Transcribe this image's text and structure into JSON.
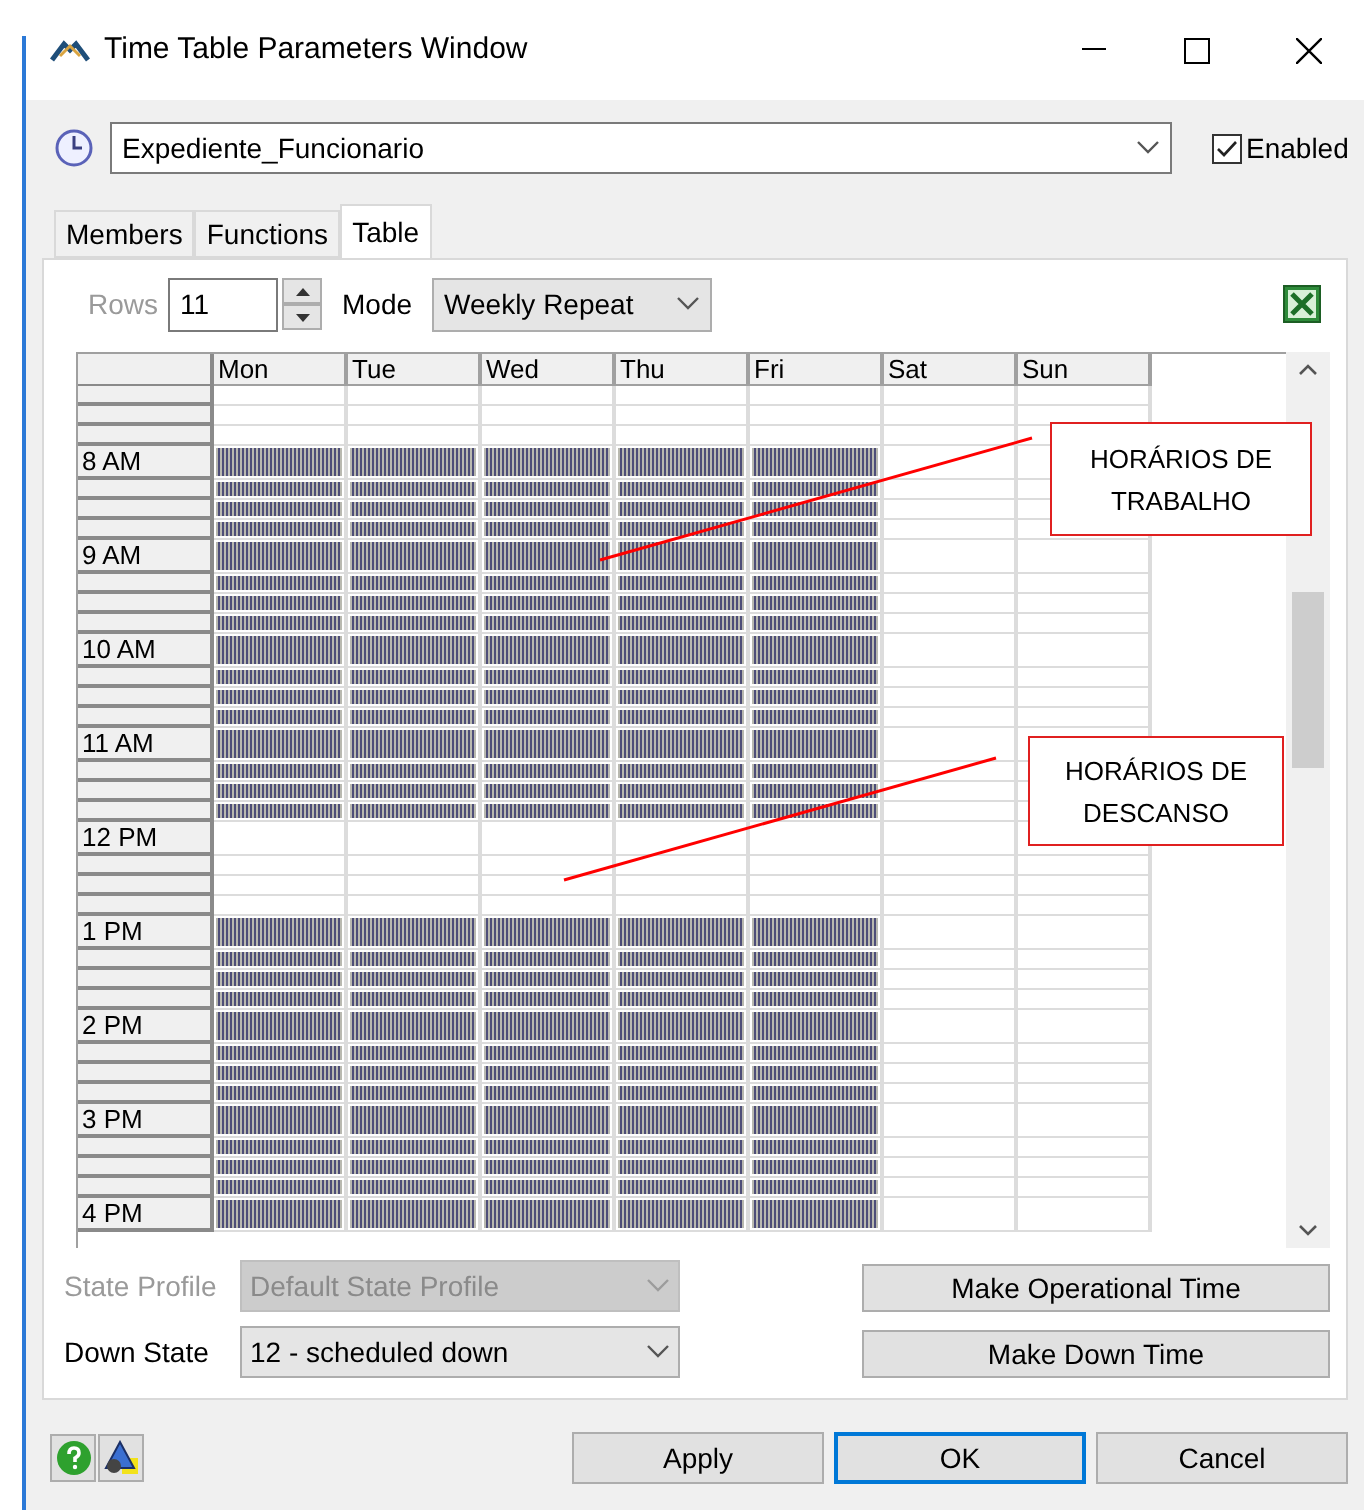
{
  "window": {
    "title": "Time Table Parameters Window"
  },
  "schedule": {
    "name": "Expediente_Funcionario"
  },
  "enabled": {
    "label": "Enabled",
    "checked": true
  },
  "tabs": [
    {
      "label": "Members",
      "selected": false
    },
    {
      "label": "Functions",
      "selected": false
    },
    {
      "label": "Table",
      "selected": true
    }
  ],
  "toolbar": {
    "rows_label": "Rows",
    "rows_value": "11",
    "mode_label": "Mode",
    "mode_value": "Weekly Repeat"
  },
  "table": {
    "columns": [
      "Mon",
      "Tue",
      "Wed",
      "Thu",
      "Fri",
      "Sat",
      "Sun"
    ],
    "rows": [
      {
        "cells": [
          false,
          false,
          false,
          false,
          false,
          false,
          false
        ]
      },
      {
        "cells": [
          false,
          false,
          false,
          false,
          false,
          false,
          false
        ]
      },
      {
        "cells": [
          false,
          false,
          false,
          false,
          false,
          false,
          false
        ]
      },
      {
        "label": "8 AM",
        "cells": [
          true,
          true,
          true,
          true,
          true,
          false,
          false
        ]
      },
      {
        "cells": [
          true,
          true,
          true,
          true,
          true,
          false,
          false
        ]
      },
      {
        "cells": [
          true,
          true,
          true,
          true,
          true,
          false,
          false
        ]
      },
      {
        "cells": [
          true,
          true,
          true,
          true,
          true,
          false,
          false
        ]
      },
      {
        "label": "9 AM",
        "cells": [
          true,
          true,
          true,
          true,
          true,
          false,
          false
        ]
      },
      {
        "cells": [
          true,
          true,
          true,
          true,
          true,
          false,
          false
        ]
      },
      {
        "cells": [
          true,
          true,
          true,
          true,
          true,
          false,
          false
        ]
      },
      {
        "cells": [
          true,
          true,
          true,
          true,
          true,
          false,
          false
        ]
      },
      {
        "label": "10 AM",
        "cells": [
          true,
          true,
          true,
          true,
          true,
          false,
          false
        ]
      },
      {
        "cells": [
          true,
          true,
          true,
          true,
          true,
          false,
          false
        ]
      },
      {
        "cells": [
          true,
          true,
          true,
          true,
          true,
          false,
          false
        ]
      },
      {
        "cells": [
          true,
          true,
          true,
          true,
          true,
          false,
          false
        ]
      },
      {
        "label": "11 AM",
        "cells": [
          true,
          true,
          true,
          true,
          true,
          false,
          false
        ]
      },
      {
        "cells": [
          true,
          true,
          true,
          true,
          true,
          false,
          false
        ]
      },
      {
        "cells": [
          true,
          true,
          true,
          true,
          true,
          false,
          false
        ]
      },
      {
        "cells": [
          true,
          true,
          true,
          true,
          true,
          false,
          false
        ]
      },
      {
        "label": "12 PM",
        "cells": [
          false,
          false,
          false,
          false,
          false,
          false,
          false
        ]
      },
      {
        "cells": [
          false,
          false,
          false,
          false,
          false,
          false,
          false
        ]
      },
      {
        "cells": [
          false,
          false,
          false,
          false,
          false,
          false,
          false
        ]
      },
      {
        "cells": [
          false,
          false,
          false,
          false,
          false,
          false,
          false
        ]
      },
      {
        "label": "1 PM",
        "cells": [
          true,
          true,
          true,
          true,
          true,
          false,
          false
        ]
      },
      {
        "cells": [
          true,
          true,
          true,
          true,
          true,
          false,
          false
        ]
      },
      {
        "cells": [
          true,
          true,
          true,
          true,
          true,
          false,
          false
        ]
      },
      {
        "cells": [
          true,
          true,
          true,
          true,
          true,
          false,
          false
        ]
      },
      {
        "label": "2 PM",
        "cells": [
          true,
          true,
          true,
          true,
          true,
          false,
          false
        ]
      },
      {
        "cells": [
          true,
          true,
          true,
          true,
          true,
          false,
          false
        ]
      },
      {
        "cells": [
          true,
          true,
          true,
          true,
          true,
          false,
          false
        ]
      },
      {
        "cells": [
          true,
          true,
          true,
          true,
          true,
          false,
          false
        ]
      },
      {
        "label": "3 PM",
        "cells": [
          true,
          true,
          true,
          true,
          true,
          false,
          false
        ]
      },
      {
        "cells": [
          true,
          true,
          true,
          true,
          true,
          false,
          false
        ]
      },
      {
        "cells": [
          true,
          true,
          true,
          true,
          true,
          false,
          false
        ]
      },
      {
        "cells": [
          true,
          true,
          true,
          true,
          true,
          false,
          false
        ]
      },
      {
        "label": "4 PM",
        "cells": [
          true,
          true,
          true,
          true,
          true,
          false,
          false
        ]
      }
    ]
  },
  "annotations": [
    {
      "text": "HORÁRIOS DE TRABALHO"
    },
    {
      "text": "HORÁRIOS DE DESCANSO"
    }
  ],
  "state_profile": {
    "label": "State Profile",
    "value": "Default State Profile",
    "disabled": true
  },
  "down_state": {
    "label": "Down State",
    "value": "12 - scheduled down",
    "disabled": false
  },
  "actions": [
    "Make Operational Time",
    "Make Down Time"
  ],
  "buttons": [
    {
      "label": "Apply",
      "default": false
    },
    {
      "label": "OK",
      "default": true
    },
    {
      "label": "Cancel",
      "default": false
    }
  ]
}
